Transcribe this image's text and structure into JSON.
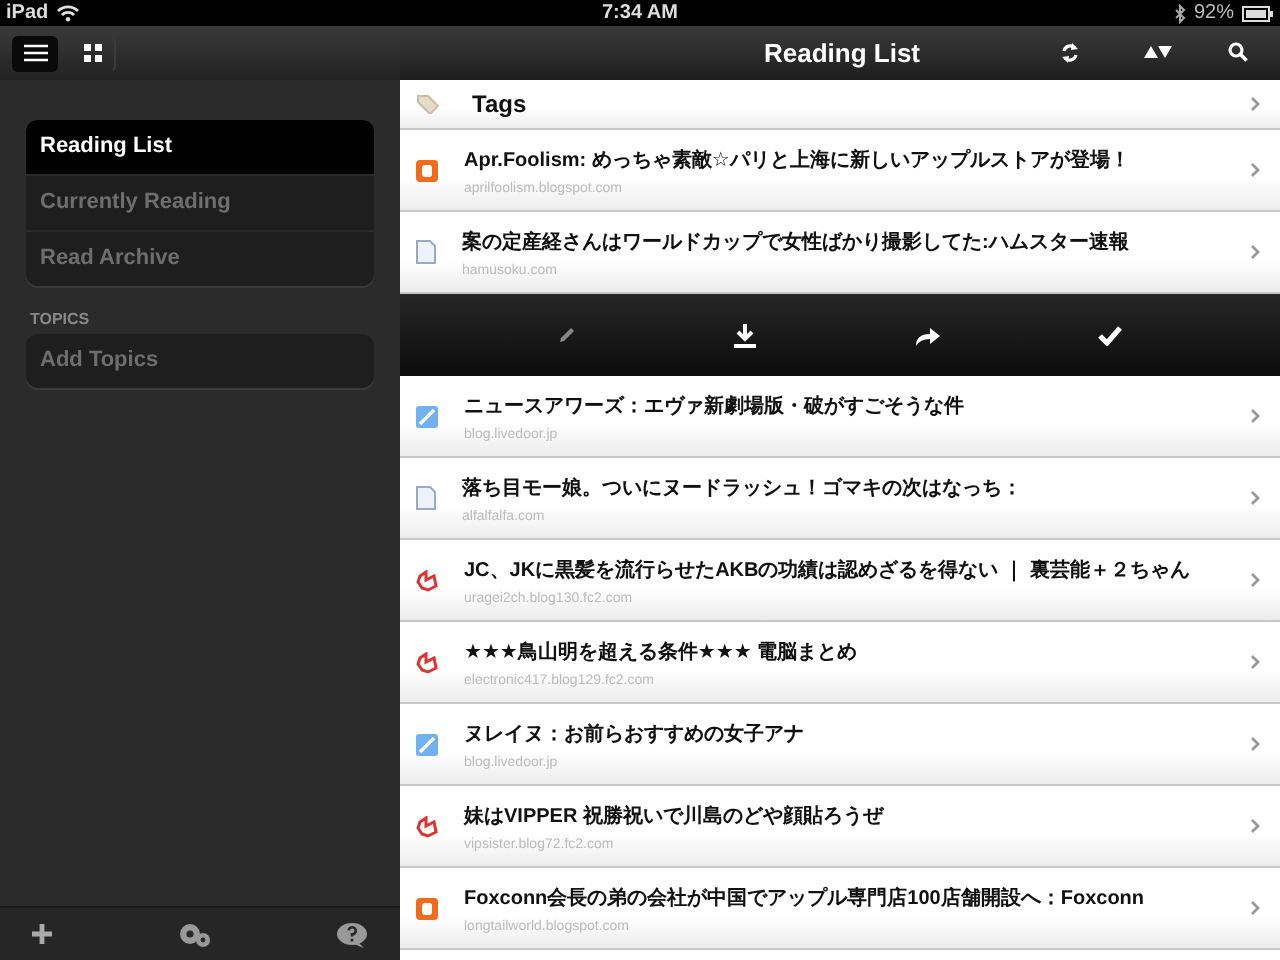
{
  "status_bar": {
    "device": "iPad",
    "time": "7:34 AM",
    "battery": "92%"
  },
  "sidebar": {
    "items": [
      {
        "label": "Reading List",
        "selected": true
      },
      {
        "label": "Currently Reading",
        "selected": false
      },
      {
        "label": "Read Archive",
        "selected": false
      }
    ],
    "topics_heading": "TOPICS",
    "topics_items": [
      {
        "label": "Add Topics",
        "selected": false
      }
    ]
  },
  "header": {
    "title": "Reading List"
  },
  "tags_row": {
    "label": "Tags"
  },
  "articles_top": [
    {
      "kind": "blogger",
      "title": "Apr.Foolism: めっちゃ素敵☆パリと上海に新しいアップルストアが登場！",
      "source": "aprilfoolism.blogspot.com"
    },
    {
      "kind": "page",
      "title": "案の定産経さんはワールドカップで女性ばかり撮影してた:ハムスター速報",
      "source": "hamusoku.com"
    }
  ],
  "articles": [
    {
      "kind": "livedoor",
      "title": "ニュースアワーズ：エヴァ新劇場版・破がすごそうな件",
      "source": "blog.livedoor.jp"
    },
    {
      "kind": "page",
      "title": "落ち目モー娘。ついにヌードラッシュ！ゴマキの次はなっち：",
      "source": "alfalfalfa.com"
    },
    {
      "kind": "fc2",
      "title": "JC、JKに黒髪を流行らせたAKBの功績は認めざるを得ない ｜ 裏芸能＋２ちゃん",
      "source": "uragei2ch.blog130.fc2.com"
    },
    {
      "kind": "fc2",
      "title": "★★★鳥山明を超える条件★★★ 電脳まとめ",
      "source": "electronic417.blog129.fc2.com"
    },
    {
      "kind": "livedoor",
      "title": "ヌレイヌ：お前らおすすめの女子アナ",
      "source": "blog.livedoor.jp"
    },
    {
      "kind": "fc2",
      "title": "妹はVIPPER 祝勝祝いで川島のどや顔貼ろうぜ",
      "source": "vipsister.blog72.fc2.com"
    },
    {
      "kind": "blogger",
      "title": "Foxconn会長の弟の会社が中国でアップル専門店100店舗開設へ：Foxconn",
      "source": "longtailworld.blogspot.com"
    }
  ]
}
